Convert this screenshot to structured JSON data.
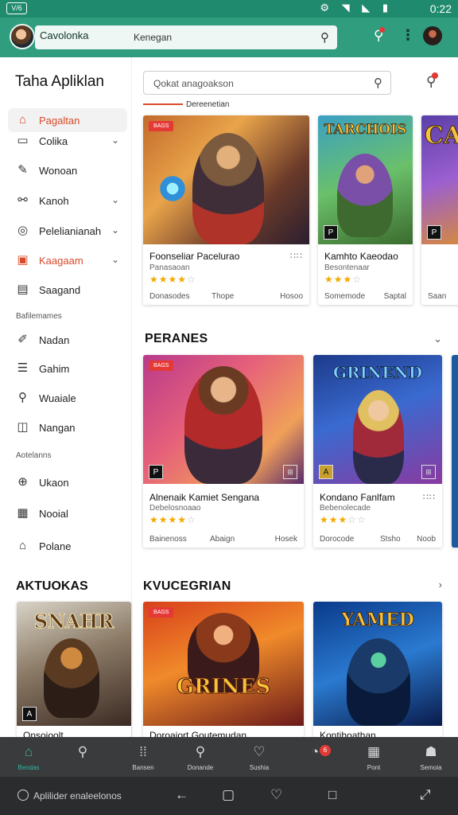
{
  "status_bar": {
    "time": "0:22",
    "left_icon": "carrier-icon",
    "right_icons": [
      "alert-icon",
      "wifi-icon",
      "signal-icon",
      "battery-icon"
    ]
  },
  "app_bar": {
    "app_name": "Cavolonka",
    "search_placeholder": "Kenegan",
    "icons": {
      "search": "search-icon",
      "notifications": "bell-icon",
      "more": "more-vert-icon",
      "profile": "avatar"
    }
  },
  "sidebar": {
    "title": "Taha Apliklan",
    "items": [
      {
        "label": "Pagaltan",
        "icon": "store-icon",
        "active": true,
        "chevron": false
      },
      {
        "label": "Colika",
        "icon": "box-icon",
        "active": false,
        "chevron": true
      },
      {
        "label": "Wonoan",
        "icon": "edit-icon",
        "active": false,
        "chevron": false
      },
      {
        "label": "Kanoh",
        "icon": "link-icon",
        "active": false,
        "chevron": true
      },
      {
        "label": "Pelelianianah",
        "icon": "target-icon",
        "active": false,
        "chevron": true
      },
      {
        "label": "Kaagaam",
        "icon": "book-icon",
        "active": false,
        "chevron": true,
        "accent": true
      },
      {
        "label": "Saagand",
        "icon": "calendar-icon",
        "active": false,
        "chevron": false
      }
    ],
    "section_1": "Bafilemames",
    "items_2": [
      {
        "label": "Nadan",
        "icon": "edit-alt-icon"
      },
      {
        "label": "Gahim",
        "icon": "list-icon"
      },
      {
        "label": "Wuaiale",
        "icon": "search-person-icon"
      },
      {
        "label": "Nangan",
        "icon": "frame-icon"
      }
    ],
    "section_2": "Aotelanns",
    "items_3": [
      {
        "label": "Ukaon",
        "icon": "globe-icon"
      },
      {
        "label": "Nooial",
        "icon": "grid-icon"
      },
      {
        "label": "Polane",
        "icon": "home-icon"
      }
    ],
    "bottom_heading": "AKTUOKAS"
  },
  "main": {
    "search_placeholder": "Qokat anagoakson",
    "row1": {
      "subtitle": "Dereenetian",
      "cards": [
        {
          "tag": "BAGS",
          "title": "Foonseliar Pacelurao",
          "subtitle": "Panasaoan",
          "rating": 4,
          "half": true,
          "meta": [
            "Donasodes",
            "Thope",
            "Hosoo"
          ],
          "art_text": ""
        },
        {
          "tag": "",
          "title": "Kamhto Kaeodao",
          "subtitle": "Besontenaar",
          "rating": 3,
          "half": true,
          "meta": [
            "Somemode",
            "Saptal"
          ],
          "art_text": "TARCHOIS"
        },
        {
          "tag": "",
          "title": "",
          "subtitle": "",
          "rating": 0,
          "half": false,
          "meta": [
            "Saan"
          ],
          "art_text": "CA"
        }
      ]
    },
    "row2": {
      "heading": "PERANES",
      "cards": [
        {
          "tag": "BAGS",
          "title": "Alnenaik Kamiet Sengana",
          "subtitle": "Debelosnoaao",
          "rating": 4,
          "half": false,
          "meta": [
            "Bainenoss",
            "Abaign",
            "Hosek"
          ],
          "art_text": ""
        },
        {
          "tag": "",
          "title": "Kondano Fanlfam",
          "subtitle": "Bebenolecade",
          "rating": 3,
          "half": true,
          "meta": [
            "Dorocode",
            "Stsho",
            "Noob"
          ],
          "art_text": "GRINEND"
        }
      ]
    },
    "row3": {
      "heading": "KVUCEGRIAN",
      "cards": [
        {
          "tag": "",
          "title": "Onsoioolt",
          "art_text": "SNAHR"
        },
        {
          "tag": "BAGS",
          "title": "Doroaiort Goutemudan",
          "art_text": "GRINES"
        },
        {
          "tag": "",
          "title": "Kontihoathan",
          "art_text": "YAMED"
        }
      ]
    }
  },
  "bottom_nav": {
    "items": [
      {
        "label": "Bendas",
        "icon": "home-icon",
        "active": true
      },
      {
        "label": "",
        "icon": "search-icon",
        "active": false
      },
      {
        "label": "Bansen",
        "icon": "apps-icon",
        "active": false
      },
      {
        "label": "Donande",
        "icon": "chat-icon",
        "active": false
      },
      {
        "label": "Sushia",
        "icon": "heart-icon",
        "active": false
      },
      {
        "label": "",
        "icon": "notification-icon",
        "active": false,
        "badge": "6"
      },
      {
        "label": "Pont",
        "icon": "grid-icon",
        "active": false
      },
      {
        "label": "Semoia",
        "icon": "profile-icon",
        "active": false
      }
    ]
  },
  "system_nav": {
    "hint": "Aplilider enaleelonos"
  },
  "colors": {
    "status_bar": "#1f8a6d",
    "app_bar": "#2f9d7e",
    "accent_red": "#d84a2b",
    "star": "#f2a900",
    "bottom_nav": "#3a3b3d",
    "active_teal": "#2fb6a0"
  }
}
